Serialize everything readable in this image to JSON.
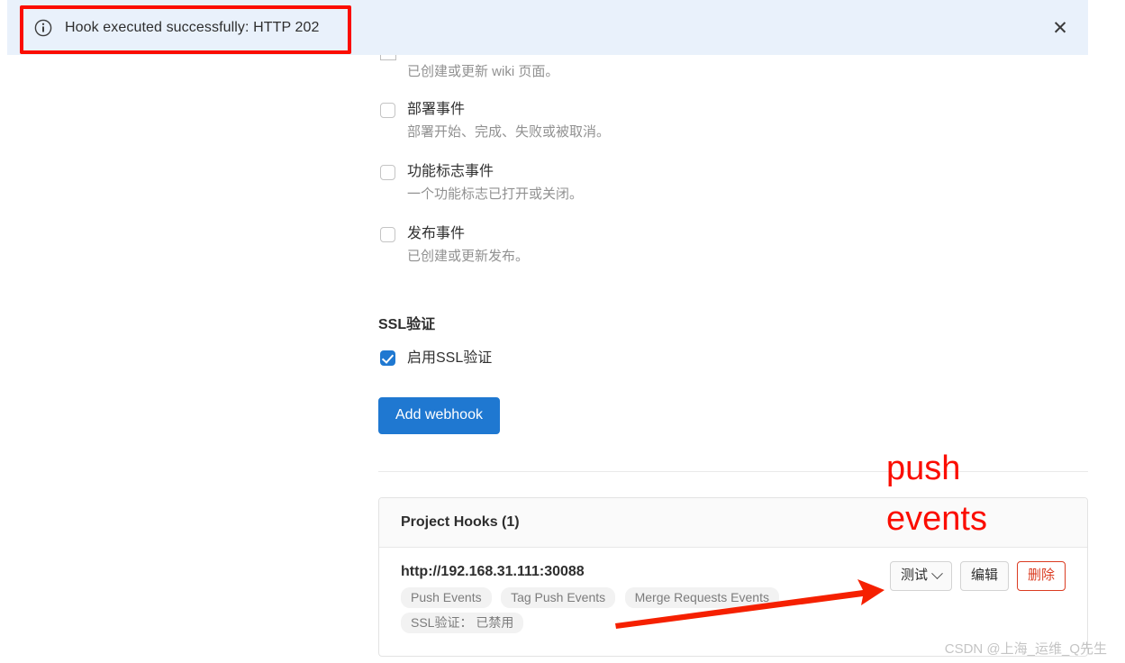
{
  "alert": {
    "icon": "info-circle-icon",
    "message": "Hook executed successfully: HTTP 202",
    "close_label": "✕",
    "background_color": "#e9f1fb"
  },
  "annotations": {
    "box_color": "#fb0d00",
    "label_line1": "push",
    "label_line2": "events",
    "arrow_color": "#f52000"
  },
  "form": {
    "events": [
      {
        "title": "",
        "desc": "已创建或更新 wiki 页面。",
        "checked": false,
        "partial": true
      },
      {
        "title": "部署事件",
        "desc": "部署开始、完成、失败或被取消。",
        "checked": false,
        "partial": false
      },
      {
        "title": "功能标志事件",
        "desc": "一个功能标志已打开或关闭。",
        "checked": false,
        "partial": false
      },
      {
        "title": "发布事件",
        "desc": "已创建或更新发布。",
        "checked": false,
        "partial": false
      }
    ],
    "ssl_section_title": "SSL验证",
    "ssl_checkbox_label": "启用SSL验证",
    "ssl_checked": true,
    "submit_label": "Add webhook",
    "submit_color": "#1f78d1"
  },
  "hooks_card": {
    "header_title": "Project Hooks (1)",
    "hook": {
      "url": "http://192.168.31.111:30088",
      "badges": [
        "Push Events",
        "Tag Push Events",
        "Merge Requests Events",
        "SSL验证： 已禁用"
      ],
      "actions": {
        "test_label": "测试",
        "test_icon": "chevron-down-icon",
        "edit_label": "编辑",
        "delete_label": "删除",
        "delete_color": "#db3b21"
      }
    }
  },
  "watermark": "CSDN @上海_运维_Q先生"
}
